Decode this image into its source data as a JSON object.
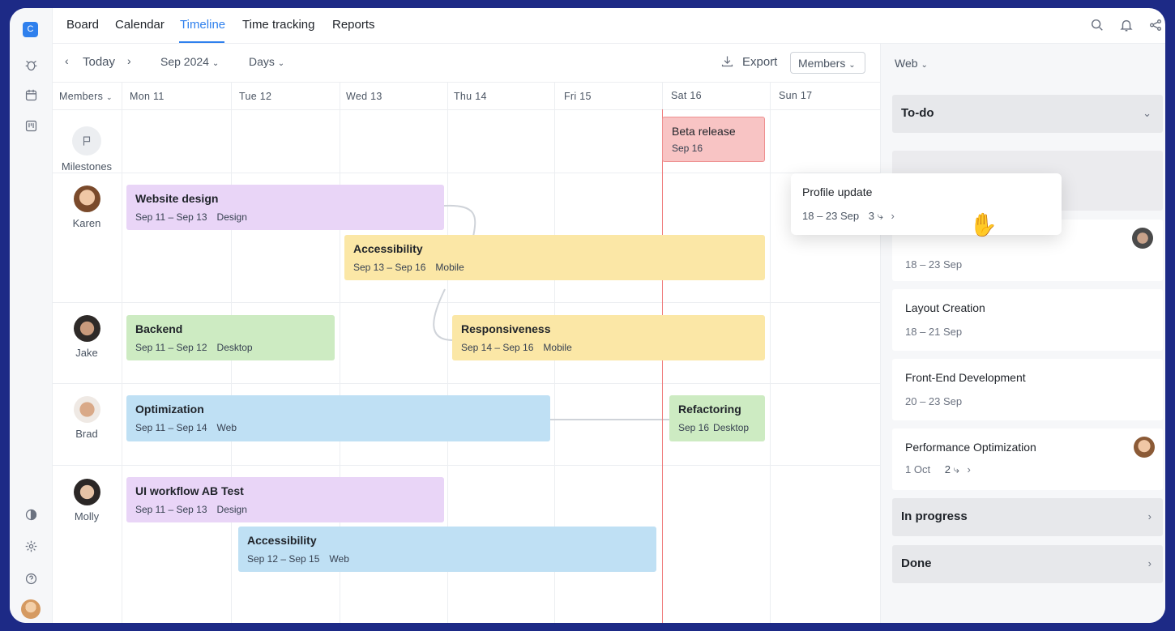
{
  "app": {
    "logo_letter": "C"
  },
  "nav": {
    "items": [
      "Board",
      "Calendar",
      "Timeline",
      "Time tracking",
      "Reports"
    ],
    "active": "Timeline"
  },
  "toolbar": {
    "today": "Today",
    "month": "Sep 2024",
    "scale": "Days",
    "export": "Export",
    "members": "Members"
  },
  "grid": {
    "members_header": "Members",
    "days": [
      "Mon 11",
      "Tue 12",
      "Wed 13",
      "Thu 14",
      "Fri 15",
      "Sat 16",
      "Sun 17"
    ],
    "milestones_label": "Milestones",
    "members": [
      {
        "name": "Karen"
      },
      {
        "name": "Jake"
      },
      {
        "name": "Brad"
      },
      {
        "name": "Molly"
      }
    ],
    "tasks": [
      {
        "title": "Beta release",
        "dates": "Sep 16",
        "tag": ""
      },
      {
        "title": "Website design",
        "dates": "Sep 11 –  Sep 13",
        "tag": "Design"
      },
      {
        "title": "Accessibility",
        "dates": "Sep 13 –  Sep 16",
        "tag": "Mobile"
      },
      {
        "title": "Backend",
        "dates": "Sep 11 –  Sep 12",
        "tag": "Desktop"
      },
      {
        "title": "Responsiveness",
        "dates": "Sep 14 –  Sep 16",
        "tag": "Mobile"
      },
      {
        "title": "Optimization",
        "dates": "Sep 11 –  Sep 14",
        "tag": "Web"
      },
      {
        "title": "Refactoring",
        "dates": "Sep 16",
        "tag": "Desktop"
      },
      {
        "title": "UI workflow AB Test",
        "dates": "Sep 11 –  Sep 13",
        "tag": "Design"
      },
      {
        "title": "Accessibility",
        "dates": "Sep 12 –  Sep 15",
        "tag": "Web"
      }
    ]
  },
  "panel": {
    "filter": "Web",
    "sections": {
      "todo": "To-do",
      "in_progress": "In progress",
      "done": "Done"
    },
    "popup": {
      "title": "Profile update",
      "dates": "18 – 23 Sep",
      "subtasks": "3"
    },
    "cards": [
      {
        "title": "",
        "dates": "18 – 23 Sep"
      },
      {
        "title": "Layout Creation",
        "dates": "18 – 21 Sep"
      },
      {
        "title": "Front-End Development",
        "dates": "20 – 23 Sep"
      },
      {
        "title": "Performance Optimization",
        "dates": "1 Oct",
        "subtasks": "2"
      }
    ]
  },
  "colors": {
    "accent": "#2f80ed",
    "today_line": "#ef7b7b",
    "purple": "#e9d5f7",
    "yellow": "#fbe7a6",
    "green": "#cdebc2",
    "blue": "#bfe0f4",
    "red": "#f8c4c4"
  }
}
